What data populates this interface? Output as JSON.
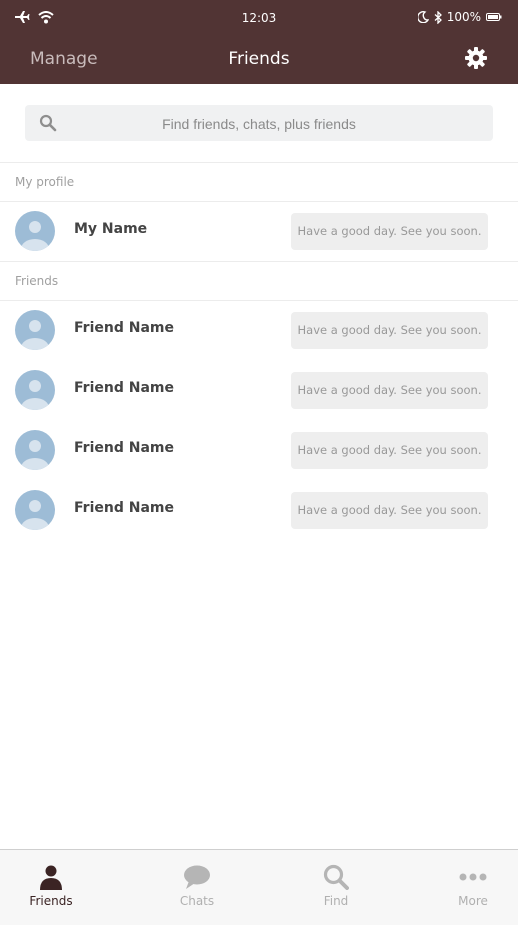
{
  "status_bar": {
    "time": "12:03",
    "battery": "100%"
  },
  "nav": {
    "left_label": "Manage",
    "title": "Friends"
  },
  "search": {
    "placeholder": "Find friends, chats, plus friends"
  },
  "sections": {
    "my_profile": "My profile",
    "friends": "Friends"
  },
  "my_profile": {
    "name": "My Name",
    "status": "Have a good day. See you soon."
  },
  "friends": [
    {
      "name": "Friend Name",
      "status": "Have a good day. See you soon."
    },
    {
      "name": "Friend Name",
      "status": "Have a good day. See you soon."
    },
    {
      "name": "Friend Name",
      "status": "Have a good day. See you soon."
    },
    {
      "name": "Friend Name",
      "status": "Have a good day. See you soon."
    }
  ],
  "tabs": [
    {
      "label": "Friends",
      "icon": "person-icon",
      "active": true
    },
    {
      "label": "Chats",
      "icon": "chat-bubble-icon",
      "active": false
    },
    {
      "label": "Find",
      "icon": "search-icon",
      "active": false
    },
    {
      "label": "More",
      "icon": "more-dots-icon",
      "active": false
    }
  ],
  "colors": {
    "header_bg": "#513434",
    "avatar_bg": "#9dbcd6",
    "active_tab": "#3b2424"
  }
}
